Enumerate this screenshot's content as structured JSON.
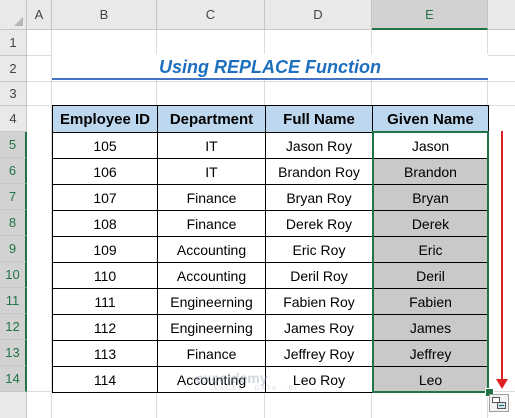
{
  "sheet": {
    "columns": [
      "A",
      "B",
      "C",
      "D",
      "E"
    ],
    "rows": [
      "1",
      "2",
      "3",
      "4",
      "5",
      "6",
      "7",
      "8",
      "9",
      "10",
      "11",
      "12",
      "13",
      "14"
    ]
  },
  "title": "Using REPLACE Function",
  "table": {
    "headers": [
      "Employee ID",
      "Department",
      "Full Name",
      "Given Name"
    ],
    "rows": [
      [
        "105",
        "IT",
        "Jason Roy",
        "Jason"
      ],
      [
        "106",
        "IT",
        "Brandon Roy",
        "Brandon"
      ],
      [
        "107",
        "Finance",
        "Bryan Roy",
        "Bryan"
      ],
      [
        "108",
        "Finance",
        "Derek Roy",
        "Derek"
      ],
      [
        "109",
        "Accounting",
        "Eric Roy",
        "Eric"
      ],
      [
        "110",
        "Accounting",
        "Deril Roy",
        "Deril"
      ],
      [
        "111",
        "Engineerning",
        "Fabien Roy",
        "Fabien"
      ],
      [
        "112",
        "Engineerning",
        "James Roy",
        "James"
      ],
      [
        "113",
        "Finance",
        "Jeffrey Roy",
        "Jeffrey"
      ],
      [
        "114",
        "Accounting",
        "Leo Roy",
        "Leo"
      ]
    ]
  },
  "watermark": {
    "brand": "exceldemy",
    "tagline": "EXCEL · DATA · BI"
  },
  "colors": {
    "header_fill": "#bdd7ee",
    "selection_fill": "#c9c9c9",
    "selection_border": "#217346",
    "title": "#1f6fbf",
    "arrow": "#e02020"
  },
  "icons": {
    "autofill": "autofill-options-icon"
  }
}
